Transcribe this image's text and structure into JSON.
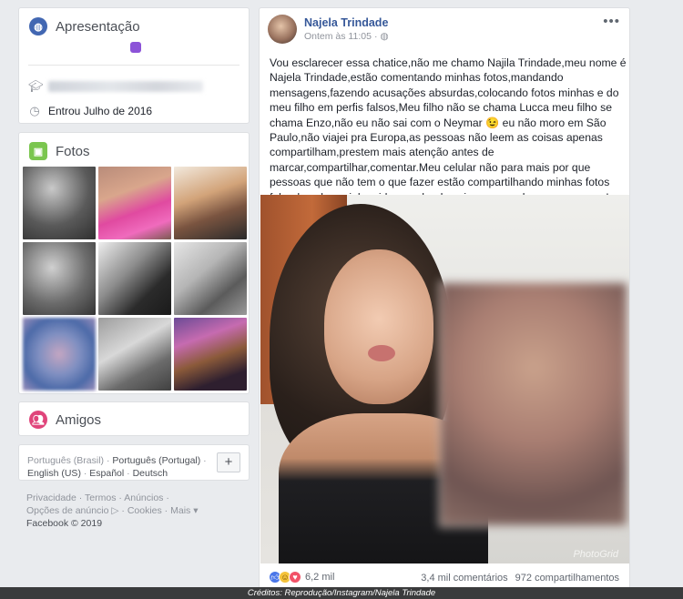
{
  "intro": {
    "title": "Apresentação",
    "joined": "Entrou Julho de 2016"
  },
  "photos": {
    "title": "Fotos"
  },
  "friends": {
    "title": "Amigos"
  },
  "languages": {
    "line1_a": "Português (Brasil)",
    "line1_b": "Português (Portugal)",
    "line2_a": "English (US)",
    "line2_b": "Español",
    "line2_c": "Deutsch",
    "add_label": "+"
  },
  "footer": {
    "l1_a": "Privacidade",
    "l1_b": "Termos",
    "l1_c": "Anúncios",
    "l2_a": "Opções de anúncio",
    "l2_b": "Cookies",
    "l2_c": "Mais",
    "l3": "Facebook © 2019"
  },
  "post": {
    "author": "Najela Trindade",
    "time": "Ontem às 11:05",
    "text": "Vou esclarecer essa chatice,não me chamo Najila Trindade,meu nome é Najela Trindade,estão comentando minhas fotos,mandando mensagens,fazendo acusações absurdas,colocando fotos minhas e do meu filho em perfis falsos,Meu filho não se chama Lucca meu filho se chama Enzo,não eu não sai com o Neymar 😉 eu não moro em São Paulo,não viajei pra Europa,as pessoas não leem as coisas apenas compartilham,prestem mais atenção antes de marcar,compartilhar,comentar.Meu celular não para mais por que pessoas que não tem o que fazer estão compartilhando minhas fotos falando sobre minha vida mandando coisas,sem saber quem sou eu! Então parem não sou a guria que saiu com o Neymar!",
    "watermark": "PhotoGrid",
    "reactions_count": "6,2 mil",
    "comments": "3,4 mil comentários",
    "shares": "972 compartilhamentos"
  },
  "credit": "Créditos: Reprodução/Instagram/Najela Trindade",
  "icons": {
    "intro": "globe-icon",
    "education": "graduation-cap-icon",
    "joined": "clock-icon",
    "photos": "photo-icon",
    "friends": "friends-icon",
    "privacy": "globe-icon",
    "more": "more-dots-icon"
  },
  "colors": {
    "brand": "#365899",
    "background": "#e9ebee"
  }
}
